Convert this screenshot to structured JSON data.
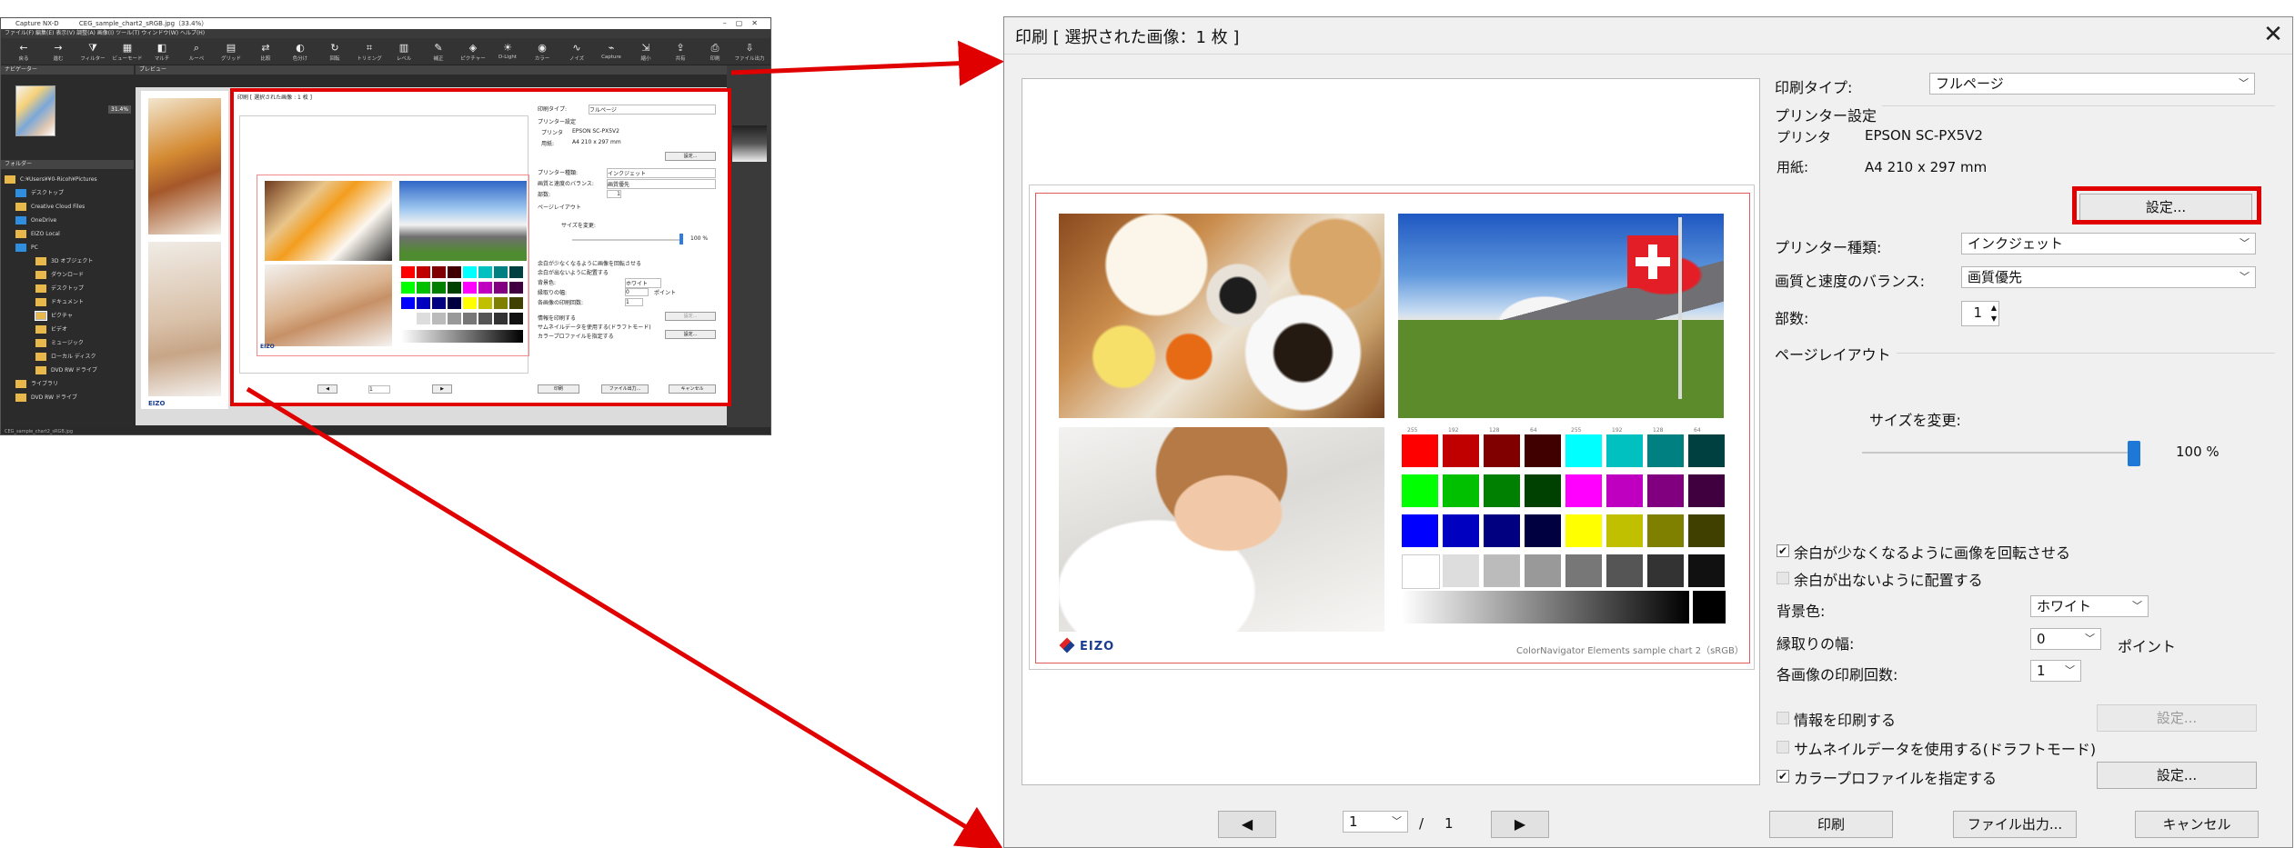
{
  "app": {
    "title": "Capture NX-D",
    "file": "CEG_sample_chart2_sRGB.jpg（33.4%）",
    "menu": "ファイル(F)  編集(E)  表示(V)  調整(A)  画像(I)  ツール(T)  ウィンドウ(W)  ヘルプ(H)",
    "toolbar": [
      "戻る",
      "進む",
      "フィルター",
      "ビューモード",
      "マルチ",
      "ルーペ",
      "グリッド",
      "比較",
      "色分け",
      "回転",
      "トリミング",
      "レベル",
      "補正",
      "ピクチャー",
      "D-Light",
      "カラー",
      "ノイズ",
      "Capture",
      "縮小",
      "共有",
      "印刷",
      "ファイル出力"
    ],
    "panels": {
      "navigator": "ナビゲーター",
      "preview": "プレビュー",
      "folder": "フォルダー"
    },
    "zoom": "31.4%",
    "tree": [
      "C:¥Users¥¥0-Ricoh¥Pictures",
      "デスクトップ",
      "Creative Cloud Files",
      "OneDrive",
      "EIZO Local",
      "PC",
      "3D オブジェクト",
      "ダウンロード",
      "デスクトップ",
      "ドキュメント",
      "ピクチャ",
      "ビデオ",
      "ミュージック",
      "ローカル ディスク",
      "DVD RW ドライブ",
      "ライブラリ",
      "DVD RW ドライブ"
    ],
    "status": "CEG_sample_chart2_sRGB.jpg"
  },
  "mini_dialog": {
    "title": "印刷 [ 選択された画像 : 1 枚 ]"
  },
  "dialog": {
    "title": "印刷 [ 選択された画像：1 枚 ]",
    "close_glyph": "✕",
    "print_type_label": "印刷タイプ:",
    "print_type_value": "フルページ",
    "printer_settings_heading": "プリンター設定",
    "printer_label": "プリンタ",
    "printer_value": "EPSON SC-PX5V2",
    "paper_label": "用紙:",
    "paper_value": "A4 210 x 297 mm",
    "settings_button": "設定...",
    "printer_kind_label": "プリンター種類:",
    "printer_kind_value": "インクジェット",
    "quality_label": "画質と速度のバランス:",
    "quality_value": "画質優先",
    "copies_label": "部数:",
    "copies_value": "1",
    "layout_heading": "ページレイアウト",
    "resize_label": "サイズを変更:",
    "resize_value": "100 %",
    "resize_level": 1.0,
    "rotate_label": "余白が少なくなるように画像を回転させる",
    "rotate_checked": true,
    "nomargin_label": "余白が出ないように配置する",
    "nomargin_checked": false,
    "bg_label": "背景色:",
    "bg_value": "ホワイト",
    "border_label": "縁取りの幅:",
    "border_value": "0",
    "border_unit": "ポイント",
    "repeat_label": "各画像の印刷回数:",
    "repeat_value": "1",
    "info_label": "情報を印刷する",
    "info_checked": false,
    "info_button": "設定...",
    "thumb_label": "サムネイルデータを使用する(ドラフトモード)",
    "thumb_checked": false,
    "profile_label": "カラープロファイルを指定する",
    "profile_checked": true,
    "profile_button": "設定...",
    "print_button": "印刷",
    "export_button": "ファイル出力...",
    "cancel_button": "キャンセル",
    "page_current": "1",
    "page_sep": "/",
    "page_total": "1",
    "prev_glyph": "◀",
    "next_glyph": "▶"
  },
  "preview": {
    "logo_text": "EIZO",
    "caption": "ColorNavigator Elements sample chart 2（sRGB）",
    "swatch_rows": [
      [
        "#ff0000",
        "#c00000",
        "#800000",
        "#400000",
        "#00ffff",
        "#00c0c0",
        "#008080",
        "#004040"
      ],
      [
        "#00ff00",
        "#00c000",
        "#008000",
        "#004000",
        "#ff00ff",
        "#c000c0",
        "#800080",
        "#400040"
      ],
      [
        "#0000ff",
        "#0000c0",
        "#000080",
        "#000040",
        "#ffff00",
        "#c0c000",
        "#808000",
        "#404000"
      ],
      [
        "#ffffff",
        "#dddddd",
        "#bbbbbb",
        "#999999",
        "#777777",
        "#555555",
        "#333333",
        "#111111"
      ]
    ],
    "tick_labels": [
      "255",
      "192",
      "128",
      "64",
      "255",
      "192",
      "128",
      "64"
    ]
  },
  "colors": {
    "highlight": "#e00000",
    "dialog_bg": "#f0f0f0"
  }
}
